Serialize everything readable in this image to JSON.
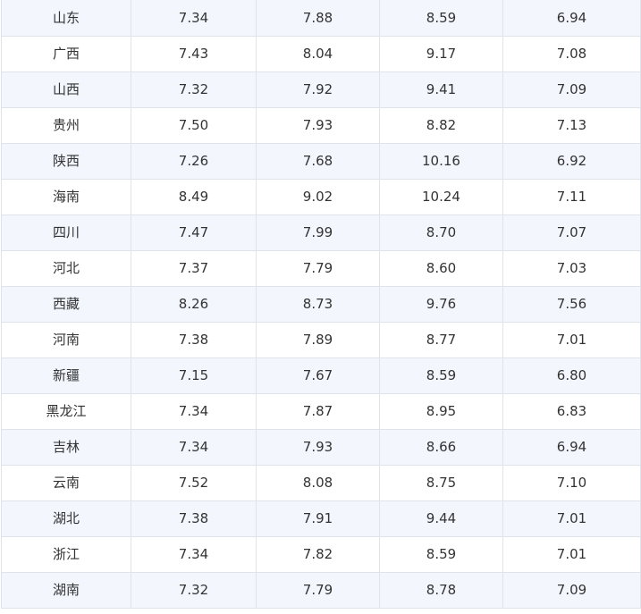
{
  "table": {
    "rows": [
      [
        "山东",
        "7.34",
        "7.88",
        "8.59",
        "6.94"
      ],
      [
        "广西",
        "7.43",
        "8.04",
        "9.17",
        "7.08"
      ],
      [
        "山西",
        "7.32",
        "7.92",
        "9.41",
        "7.09"
      ],
      [
        "贵州",
        "7.50",
        "7.93",
        "8.82",
        "7.13"
      ],
      [
        "陕西",
        "7.26",
        "7.68",
        "10.16",
        "6.92"
      ],
      [
        "海南",
        "8.49",
        "9.02",
        "10.24",
        "7.11"
      ],
      [
        "四川",
        "7.47",
        "7.99",
        "8.70",
        "7.07"
      ],
      [
        "河北",
        "7.37",
        "7.79",
        "8.60",
        "7.03"
      ],
      [
        "西藏",
        "8.26",
        "8.73",
        "9.76",
        "7.56"
      ],
      [
        "河南",
        "7.38",
        "7.89",
        "8.77",
        "7.01"
      ],
      [
        "新疆",
        "7.15",
        "7.67",
        "8.59",
        "6.80"
      ],
      [
        "黑龙江",
        "7.34",
        "7.87",
        "8.95",
        "6.83"
      ],
      [
        "吉林",
        "7.34",
        "7.93",
        "8.66",
        "6.94"
      ],
      [
        "云南",
        "7.52",
        "8.08",
        "8.75",
        "7.10"
      ],
      [
        "湖北",
        "7.38",
        "7.91",
        "9.44",
        "7.01"
      ],
      [
        "浙江",
        "7.34",
        "7.82",
        "8.59",
        "7.01"
      ],
      [
        "湖南",
        "7.32",
        "7.79",
        "8.78",
        "7.09"
      ]
    ]
  },
  "colors": {
    "row_tint": "#f3f7fd",
    "row_plain": "#ffffff",
    "border": "#dfe3ea",
    "text": "#333333"
  }
}
